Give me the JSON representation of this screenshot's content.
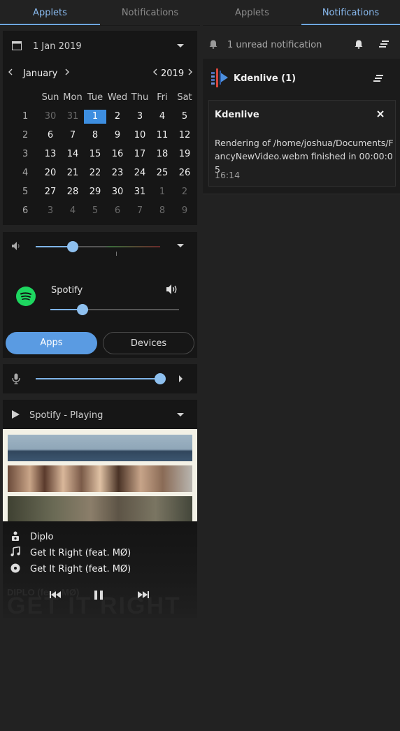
{
  "left_tabs": [
    "Applets",
    "Notifications"
  ],
  "right_tabs": [
    "Applets",
    "Notifications"
  ],
  "calendar": {
    "date_label": "1 Jan 2019",
    "month": "January",
    "year": "2019",
    "weekdays": [
      "Sun",
      "Mon",
      "Tue",
      "Wed",
      "Thu",
      "Fri",
      "Sat"
    ],
    "weeks": [
      {
        "wk": "1",
        "days": [
          "30",
          "31",
          "1",
          "2",
          "3",
          "4",
          "5"
        ]
      },
      {
        "wk": "2",
        "days": [
          "6",
          "7",
          "8",
          "9",
          "10",
          "11",
          "12"
        ]
      },
      {
        "wk": "3",
        "days": [
          "13",
          "14",
          "15",
          "16",
          "17",
          "18",
          "19"
        ]
      },
      {
        "wk": "4",
        "days": [
          "20",
          "21",
          "22",
          "23",
          "24",
          "25",
          "26"
        ]
      },
      {
        "wk": "5",
        "days": [
          "27",
          "28",
          "29",
          "30",
          "31",
          "1",
          "2"
        ]
      },
      {
        "wk": "6",
        "days": [
          "3",
          "4",
          "5",
          "6",
          "7",
          "8",
          "9"
        ]
      }
    ],
    "selected_day": "1"
  },
  "volume": {
    "master_level": 0.3,
    "app_name": "Spotify",
    "app_level": 0.25,
    "apps_button": "Apps",
    "devices_button": "Devices"
  },
  "mic": {
    "level": 1.0
  },
  "media": {
    "header": "Spotify - Playing",
    "artist": "Diplo",
    "title": "Get It Right (feat. MØ)",
    "album": "Get It Right (feat. MØ)",
    "bg_line1": "DIPLO (feat. MØ)",
    "bg_line2": "GET IT RIGHT"
  },
  "notifications": {
    "summary": "1 unread notification",
    "group_title": "Kdenlive (1)",
    "card_title": "Kdenlive",
    "card_body": "Rendering of /home/joshua/Documents/FancyNewVideo.webm finished in 00:00:05",
    "card_time": "16:14"
  },
  "colors": {
    "accent": "#3d8ee0",
    "tab_active": "#88b9ee",
    "spotify": "#1ed760"
  }
}
